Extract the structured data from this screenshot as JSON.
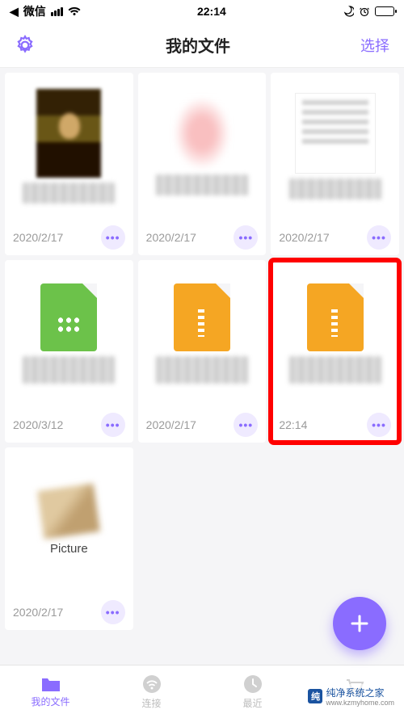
{
  "status": {
    "carrier": "微信",
    "time": "22:14"
  },
  "nav": {
    "title": "我的文件",
    "select": "选择"
  },
  "files": [
    {
      "date": "2020/2/17"
    },
    {
      "date": "2020/2/17"
    },
    {
      "date": "2020/2/17"
    },
    {
      "date": "2020/3/12"
    },
    {
      "date": "2020/2/17"
    },
    {
      "date": "22:14"
    },
    {
      "caption": "Picture",
      "date": "2020/2/17"
    }
  ],
  "tabs": {
    "files": "我的文件",
    "connect": "连接",
    "recent": "最近"
  },
  "watermark": {
    "title": "纯净系统之家",
    "url": "www.kzmyhome.com"
  },
  "colors": {
    "accent": "#8a6cff",
    "highlight": "#ff0000",
    "orange": "#f5a623",
    "green": "#6cc24a"
  }
}
